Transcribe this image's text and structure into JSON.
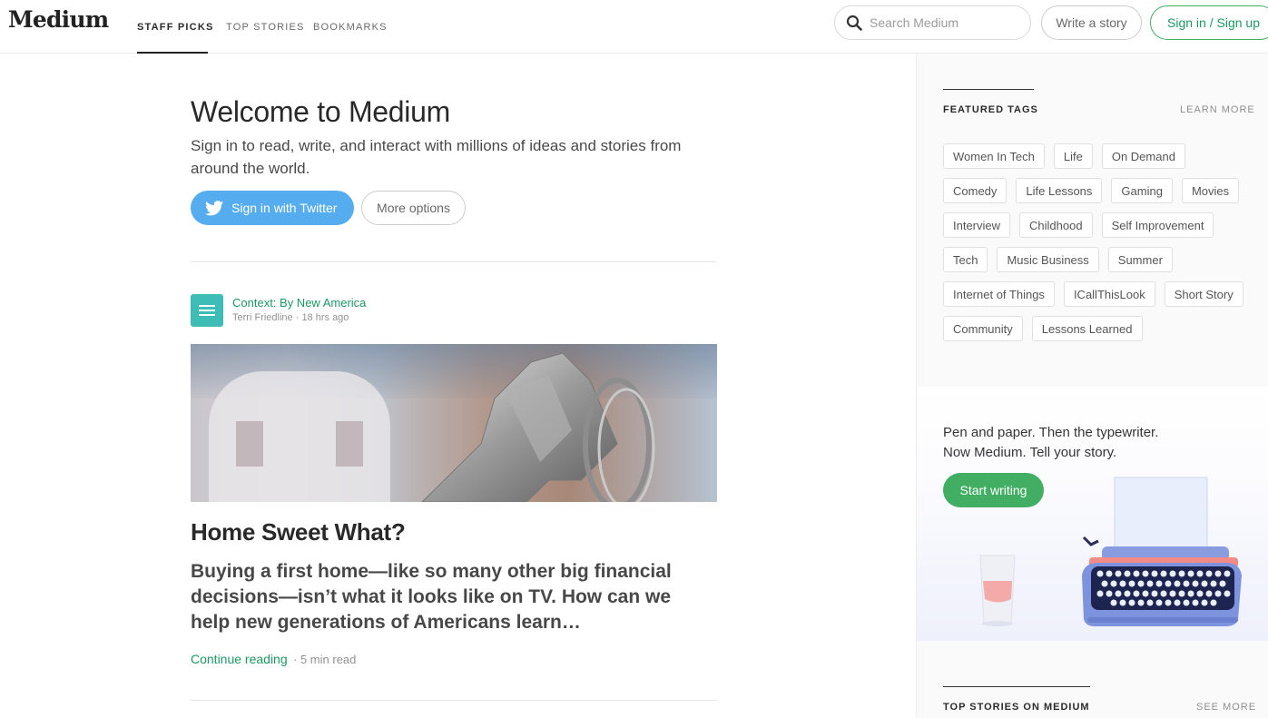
{
  "nav": {
    "logo": "Medium",
    "tabs": [
      "STAFF PICKS",
      "TOP STORIES",
      "BOOKMARKS"
    ],
    "search_placeholder": "Search Medium",
    "write_label": "Write a story",
    "signin_label": "Sign in / Sign up"
  },
  "welcome": {
    "title": "Welcome to Medium",
    "subtitle": "Sign in to read, write, and interact with millions of ideas and stories from around the world.",
    "twitter_label": "Sign in with Twitter",
    "more_label": "More options"
  },
  "story": {
    "publication": "Context: By New America",
    "author": "Terri Friedline",
    "time": "18 hrs ago",
    "meta_separator": "·",
    "title": "Home Sweet What?",
    "subtitle": "Buying a first home—like so many other big financial decisions—isn’t what it looks like on TV. How can we help new generations of Americans learn…",
    "continue_label": "Continue reading",
    "read_time": "5 min read"
  },
  "sidebar": {
    "featured_label": "FEATURED TAGS",
    "learn_more": "LEARN MORE",
    "tags": [
      "Women In Tech",
      "Life",
      "On Demand",
      "Comedy",
      "Life Lessons",
      "Gaming",
      "Movies",
      "Interview",
      "Childhood",
      "Self Improvement",
      "Tech",
      "Music Business",
      "Summer",
      "Internet of Things",
      "ICallThisLook",
      "Short Story",
      "Community",
      "Lessons Learned"
    ],
    "promo_line1": "Pen and paper. Then the typewriter.",
    "promo_line2": "Now Medium. Tell your story.",
    "start_label": "Start writing",
    "top_stories_label": "TOP STORIES ON MEDIUM",
    "see_more": "SEE MORE"
  },
  "colors": {
    "accent_green": "#1c9963",
    "button_green": "#41ae63",
    "twitter_blue": "#55acee",
    "pub_teal": "#3dbdb5"
  }
}
